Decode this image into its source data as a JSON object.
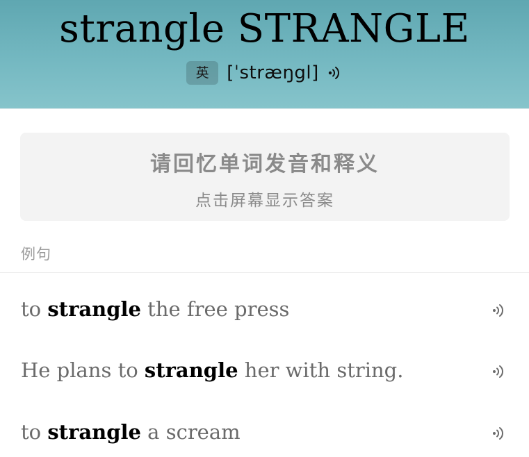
{
  "header": {
    "word": "strangle STRANGLE",
    "accent_label": "英",
    "phonetic": "[ˈstræŋgl]",
    "speaker_icon": "speaker-icon"
  },
  "prompt_card": {
    "title": "请回忆单词发音和释义",
    "subtitle": "点击屏幕显示答案"
  },
  "examples_section": {
    "label": "例句",
    "items": [
      {
        "before": "to ",
        "keyword": "strangle",
        "after": " the free press",
        "icon": "speaker-icon"
      },
      {
        "before": "He plans to ",
        "keyword": "strangle",
        "after": " her with string.",
        "icon": "speaker-icon"
      },
      {
        "before": "to ",
        "keyword": "strangle",
        "after": " a scream",
        "icon": "speaker-icon"
      }
    ]
  },
  "colors": {
    "header_top": "#5fa7b1",
    "header_bottom": "#86c4cb",
    "card_bg": "#f3f3f3",
    "muted_text": "#8a8a8a"
  }
}
